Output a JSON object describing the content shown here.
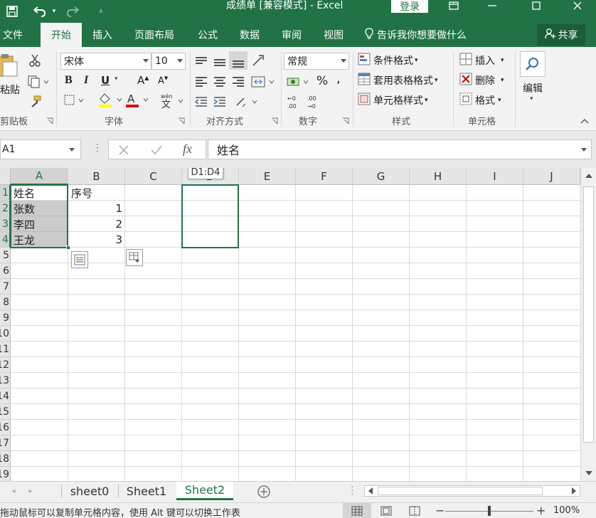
{
  "titlebar": {
    "title": "成绩单 [兼容模式] - Excel",
    "login": "登录",
    "save_icon": "save-icon",
    "undo_icon": "undo-icon",
    "redo_icon": "redo-icon"
  },
  "tabs": [
    {
      "label": "文件"
    },
    {
      "label": "开始"
    },
    {
      "label": "插入"
    },
    {
      "label": "页面布局"
    },
    {
      "label": "公式"
    },
    {
      "label": "数据"
    },
    {
      "label": "审阅"
    },
    {
      "label": "视图"
    }
  ],
  "tell_me": "告诉我你想要做什么",
  "share": "共享",
  "ribbon": {
    "clipboard": {
      "paste": "粘贴",
      "group": "剪贴板"
    },
    "font": {
      "name": "宋体",
      "size": "10",
      "group": "字体",
      "bold": "B",
      "italic": "I",
      "underline": "U",
      "grow": "A",
      "shrink": "A",
      "color": "A",
      "phonetic": "wén"
    },
    "alignment": {
      "group": "对齐方式"
    },
    "number": {
      "format": "常规",
      "group": "数字",
      "percent": "%"
    },
    "styles": {
      "conditional": "条件格式",
      "table": "套用表格格式",
      "cell": "单元格样式",
      "group": "样式"
    },
    "cells": {
      "insert": "插入",
      "delete": "删除",
      "format": "格式",
      "group": "单元格"
    },
    "editing": {
      "label": "编辑"
    }
  },
  "formula_bar": {
    "name_box": "A1",
    "fx": "fx",
    "content": "姓名"
  },
  "grid": {
    "columns": [
      "A",
      "B",
      "C",
      "D",
      "E",
      "F",
      "G",
      "H",
      "I",
      "J"
    ],
    "rows": [
      "1",
      "2",
      "3",
      "4",
      "5",
      "6",
      "7",
      "8",
      "9",
      "10",
      "11",
      "12",
      "13",
      "14",
      "15",
      "16",
      "17",
      "18",
      "19"
    ],
    "cells": {
      "A1": "姓名",
      "B1": "序号",
      "A2": "张数",
      "B2": "1",
      "A3": "李四",
      "B3": "2",
      "A4": "王龙",
      "B4": "3"
    },
    "drag_tooltip": "D1:D4"
  },
  "sheets": [
    {
      "label": "sheet0"
    },
    {
      "label": "Sheet1"
    },
    {
      "label": "Sheet2"
    }
  ],
  "status": {
    "message": "拖动鼠标可以复制单元格内容，使用 Alt 键可以切换工作表",
    "zoom": "100%",
    "minus": "−",
    "plus": "+"
  },
  "colors": {
    "accent": "#217346",
    "selection_fill": "#a0a0a0"
  }
}
